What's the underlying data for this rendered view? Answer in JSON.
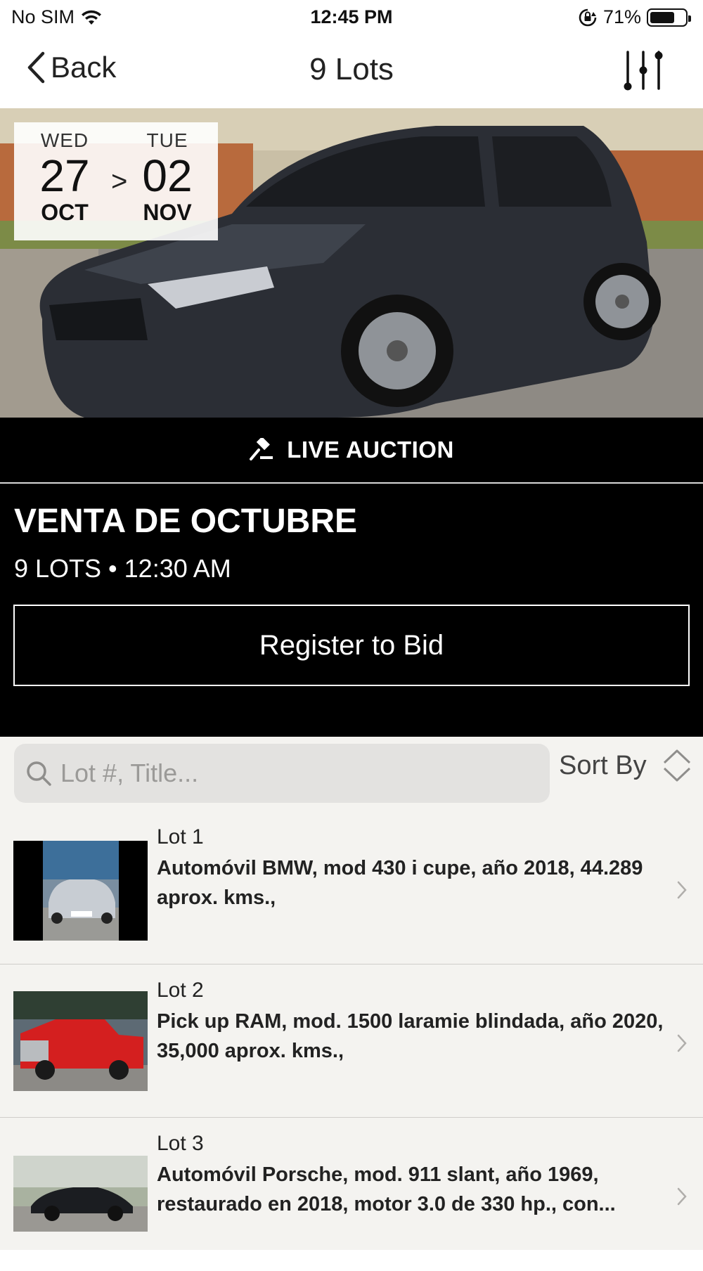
{
  "status_bar": {
    "carrier": "No SIM",
    "time": "12:45 PM",
    "battery_percent": "71%",
    "battery_level": 0.71
  },
  "nav": {
    "back_label": "Back",
    "title": "9 Lots",
    "filter_icon": "sliders-icon"
  },
  "hero": {
    "start_day": "WED",
    "start_date": "27",
    "start_month": "OCT",
    "separator": ">",
    "end_day": "TUE",
    "end_date": "02",
    "end_month": "NOV"
  },
  "auction": {
    "type_label": "LIVE AUCTION",
    "type_icon": "gavel-icon",
    "title": "VENTA DE OCTUBRE",
    "meta": "9 LOTS • 12:30 AM",
    "register_label": "Register to Bid"
  },
  "search": {
    "placeholder": "Lot #, Title...",
    "sort_label": "Sort By",
    "search_icon": "search-icon",
    "sort_icon": "sort-icon"
  },
  "lots": [
    {
      "number": "Lot 1",
      "title": "Automóvil BMW, mod 430 i cupe, año 2018, 44.289 aprox. kms.,"
    },
    {
      "number": "Lot 2",
      "title": "Pick up RAM, mod. 1500 laramie blindada, año 2020, 35,000 aprox. kms.,"
    },
    {
      "number": "Lot 3",
      "title": "Automóvil Porsche, mod. 911 slant, año 1969, restaurado en 2018, motor 3.0 de 330 hp., con..."
    }
  ]
}
